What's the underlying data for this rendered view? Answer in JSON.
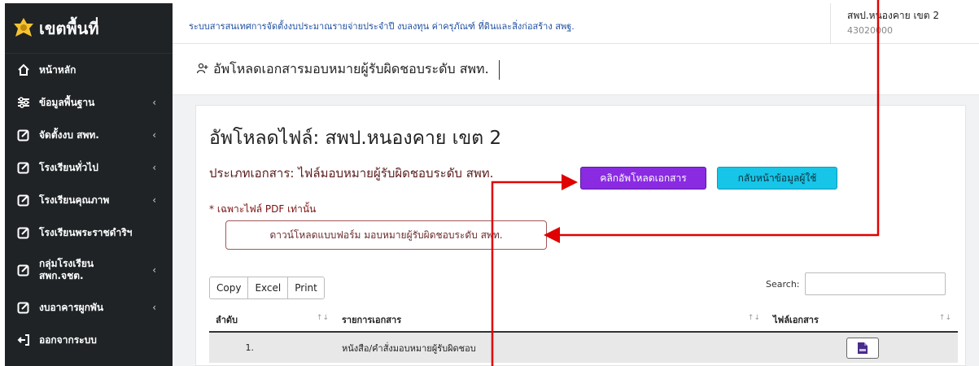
{
  "brand": {
    "name": "เขตพื้นที่"
  },
  "sidebar": {
    "items": [
      {
        "label": "หน้าหลัก",
        "icon": "home-icon",
        "has_submenu": false
      },
      {
        "label": "ข้อมูลพื้นฐาน",
        "icon": "sliders-icon",
        "has_submenu": true
      },
      {
        "label": "จัดตั้งงบ สพท.",
        "icon": "edit-icon",
        "has_submenu": true
      },
      {
        "label": "โรงเรียนทั่วไป",
        "icon": "edit-icon",
        "has_submenu": true
      },
      {
        "label": "โรงเรียนคุณภาพ",
        "icon": "edit-icon",
        "has_submenu": true
      },
      {
        "label": "โรงเรียนพระราชดำริฯ",
        "icon": "edit-icon",
        "has_submenu": true
      },
      {
        "label": "กลุ่มโรงเรียน สพก.จชต.",
        "icon": "edit-icon",
        "has_submenu": true
      },
      {
        "label": "งบอาคารผูกพัน",
        "icon": "edit-icon",
        "has_submenu": true
      },
      {
        "label": "ออกจากระบบ",
        "icon": "logout-icon",
        "has_submenu": false
      }
    ]
  },
  "header": {
    "system_title": "ระบบสารสนเทศการจัดตั้งงบประมาณรายจ่ายประจำปี งบลงทุน ค่าครุภัณฑ์ ที่ดินและสิ่งก่อสร้าง สพฐ.",
    "user_name": "สพป.หนองคาย เขต 2",
    "user_code": "43020000"
  },
  "page": {
    "title": "อัพโหลดเอกสารมอบหมายผู้รับผิดชอบระดับ สพท."
  },
  "card": {
    "upload_title": "อัพโหลดไฟล์: สพป.หนองคาย เขต 2",
    "doc_type": "ประเภทเอกสาร: ไฟล์มอบหมายผู้รับผิดชอบระดับ สพท.",
    "pdf_note": "* เฉพาะไฟล์ PDF เท่านั้น",
    "upload_button": "คลิกอัพโหลดเอกสาร",
    "back_button": "กลับหน้าข้อมูลผู้ใช้",
    "download_button": "ดาวน์โหลดแบบฟอร์ม มอบหมายผู้รับผิดชอบระดับ สพท."
  },
  "table_tools": {
    "buttons": [
      "Copy",
      "Excel",
      "Print"
    ],
    "search_label": "Search:",
    "search_value": ""
  },
  "table": {
    "columns": [
      "ลำดับ",
      "รายการเอกสาร",
      "ไฟล์เอกสาร"
    ],
    "sort_glyph": "↑↓",
    "rows": [
      {
        "no": "1.",
        "name": "หนังสือ/คำสั่งมอบหมายผู้รับผิดชอบ",
        "file_icon": "pdf-file-icon"
      }
    ]
  },
  "colors": {
    "sidebar_bg": "#1f2326",
    "upload_button": "#8a2be2",
    "back_button": "#17c5e8",
    "annotation_arrow": "#e00000"
  }
}
